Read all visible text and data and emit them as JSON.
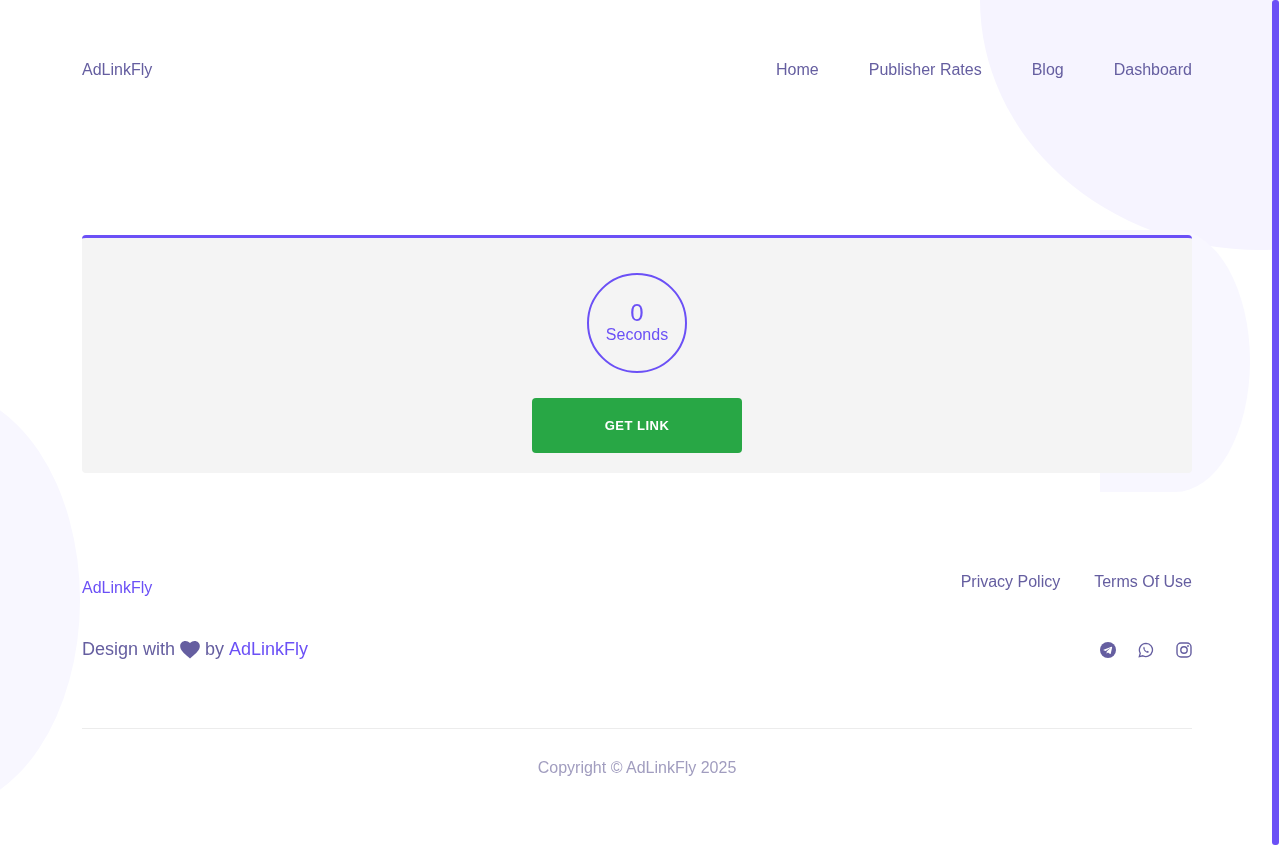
{
  "header": {
    "logo": "AdLinkFly",
    "nav": [
      "Home",
      "Publisher Rates",
      "Blog",
      "Dashboard"
    ]
  },
  "countdown": {
    "value": "0",
    "unit": "Seconds",
    "button": "GET LINK"
  },
  "footer": {
    "logo": "AdLinkFly",
    "links": [
      "Privacy Policy",
      "Terms Of Use"
    ],
    "credit": {
      "prefix": "Design with",
      "suffix": "by",
      "link": "AdLinkFly"
    },
    "copyright": "Copyright © AdLinkFly 2025"
  }
}
